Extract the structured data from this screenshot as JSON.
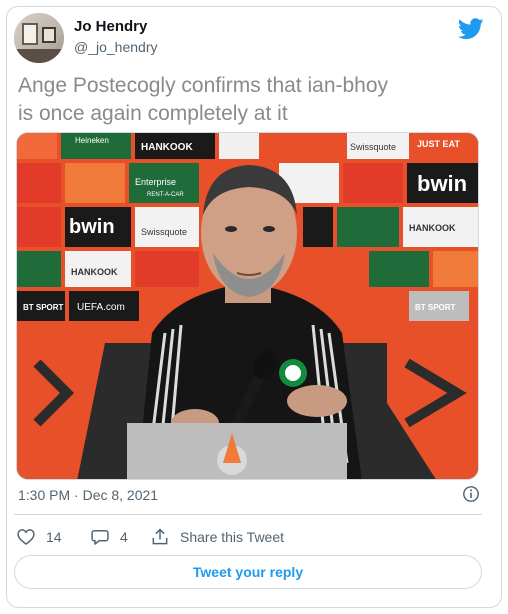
{
  "author": {
    "name": "Jo Hendry",
    "handle": "@_jo_hendry"
  },
  "tweet": {
    "text_line1": "Ange Postecogly confirms that ian-bhoy",
    "text_line2": "is once again completely at it",
    "timestamp": "1:30 PM · Dec 8, 2021"
  },
  "media": {
    "sponsor_labels": [
      "Heineken",
      "HANKOOK",
      "Swissquote",
      "JUST EAT",
      "bwin",
      "Enterprise",
      "RENT-A-CAR",
      "BT SPORT",
      "UEFA.com"
    ]
  },
  "actions": {
    "likes": "14",
    "replies": "4",
    "share_label": "Share this Tweet"
  },
  "reply_button": "Tweet your reply",
  "colors": {
    "accent": "#1d9bf0",
    "secondary_text": "#536471",
    "border": "#cfd9de"
  }
}
